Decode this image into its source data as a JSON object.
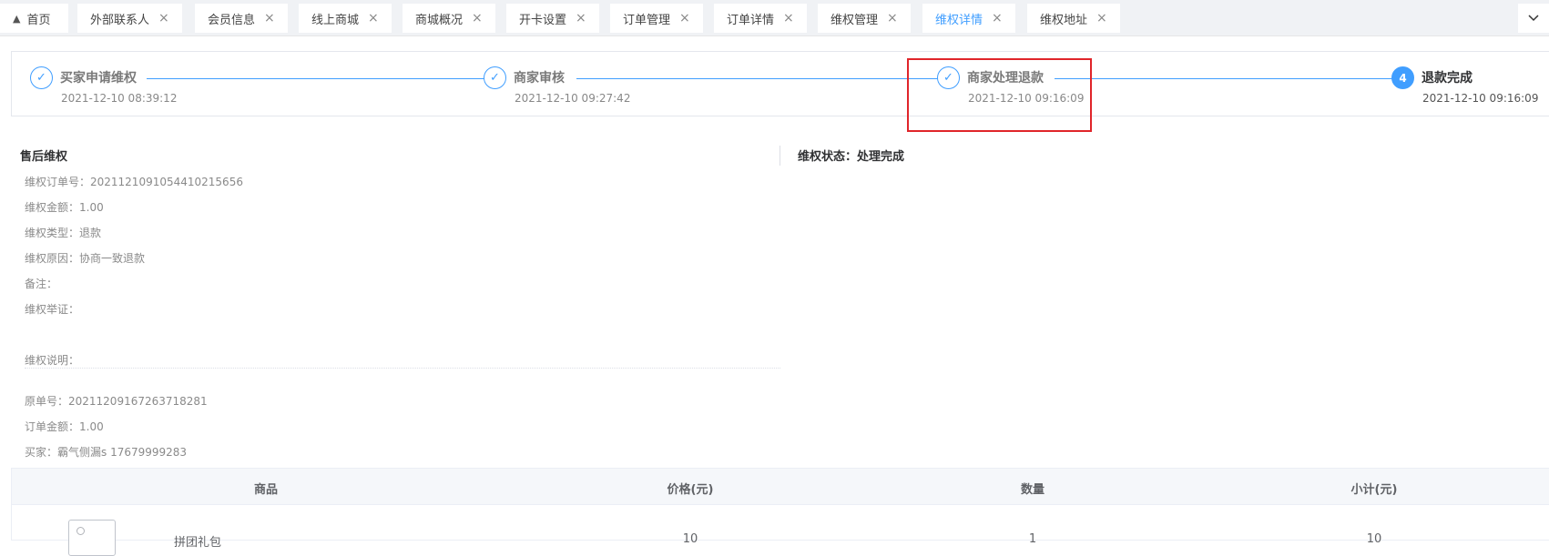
{
  "tabs": [
    {
      "label": "首页",
      "closable": false,
      "active": false
    },
    {
      "label": "外部联系人",
      "closable": true,
      "active": false
    },
    {
      "label": "会员信息",
      "closable": true,
      "active": false
    },
    {
      "label": "线上商城",
      "closable": false,
      "active": false
    },
    {
      "label": "商城概况",
      "closable": true,
      "active": false
    },
    {
      "label": "开卡设置",
      "closable": true,
      "active": false
    },
    {
      "label": "订单管理",
      "closable": true,
      "active": false
    },
    {
      "label": "订单详情",
      "closable": true,
      "active": false
    },
    {
      "label": "维权管理",
      "closable": true,
      "active": false
    },
    {
      "label": "维权详情",
      "closable": true,
      "active": true
    },
    {
      "label": "维权地址",
      "closable": true,
      "active": false
    }
  ],
  "icons": {
    "close": "×",
    "home": "home-icon",
    "check": "✓",
    "more": "chevron-down-icon"
  },
  "steps": [
    {
      "title": "买家申请维权",
      "time": "2021-12-10 08:39:12",
      "status": "done"
    },
    {
      "title": "商家审核",
      "time": "2021-12-10 09:27:42",
      "status": "done"
    },
    {
      "title": "商家处理退款",
      "time": "2021-12-10 09:16:09",
      "status": "done"
    },
    {
      "title": "退款完成",
      "time": "2021-12-10 09:16:09",
      "status": "current",
      "number": "4"
    }
  ],
  "after_sale": {
    "title": "售后维权",
    "order_no": "维权订单号：2021121091054410215656",
    "amount": "维权金额：1.00",
    "type": "维权类型：退款",
    "reason": "维权原因：协商一致退款",
    "remark": "备注：",
    "evidence": "维权举证：",
    "description": "维权说明：",
    "original_no": "原单号：20211209167263718281",
    "order_amount": "订单金额：1.00",
    "buyer": "买家：霸气侧漏s 17679999283"
  },
  "status": {
    "text": "维权状态：处理完成"
  },
  "table": {
    "headers": [
      "商品",
      "价格(元)",
      "数量",
      "小计(元)"
    ],
    "rows": [
      {
        "name": "拼团礼包",
        "price": "10",
        "qty": "1",
        "subtotal": "10"
      }
    ]
  },
  "colors": {
    "accent": "#409eff",
    "highlight": "#e0252a"
  }
}
